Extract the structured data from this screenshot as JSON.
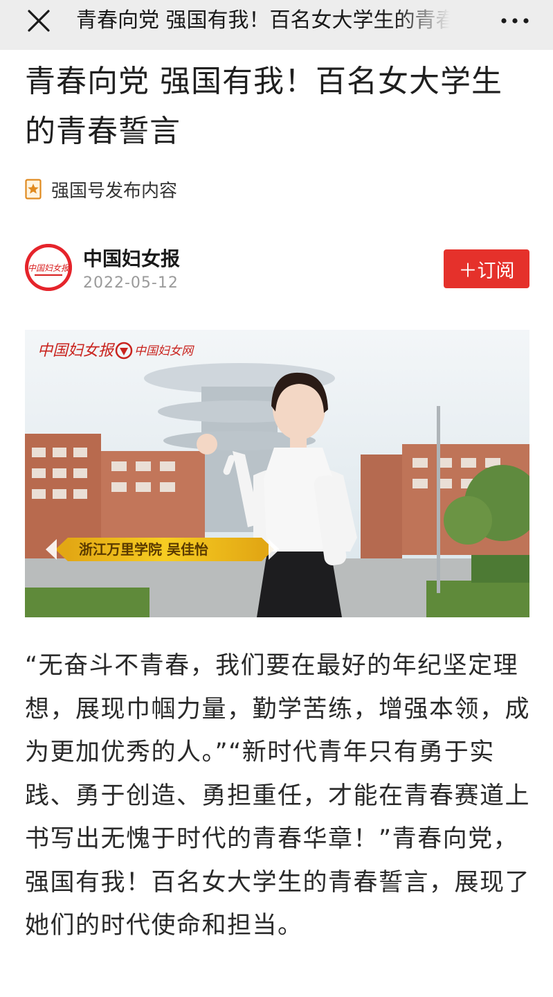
{
  "topbar": {
    "title": "青春向党 强国有我！百名女大学生的青春誓言",
    "close_icon": "close-icon",
    "more_icon": "more-icon"
  },
  "article": {
    "headline": "青春向党 强国有我！百名女大学生的青春誓言",
    "source_label": "强国号发布内容",
    "author": {
      "name": "中国妇女报",
      "date": "2022-05-12",
      "avatar_text": "中国妇女报"
    },
    "subscribe_label": "＋订阅",
    "photo": {
      "logo_newspaper": "中国妇女报",
      "logo_site": "中国妇女网",
      "caption": "浙江万里学院 吴佳怡"
    },
    "body": "“无奋斗不青春，我们要在最好的年纪坚定理想，展现巾帼力量，勤学苦练，增强本领，成为更加优秀的人。”“新时代青年只有勇于实践、勇于创造、勇担重任，才能在青春赛道上书写出无愧于时代的青春华章！”青春向党，强国有我！百名女大学生的青春誓言，展现了她们的时代使命和担当。"
  },
  "colors": {
    "accent": "#e5312b",
    "topbar_bg": "#ededed",
    "caption_bg": "#f2c21b"
  }
}
